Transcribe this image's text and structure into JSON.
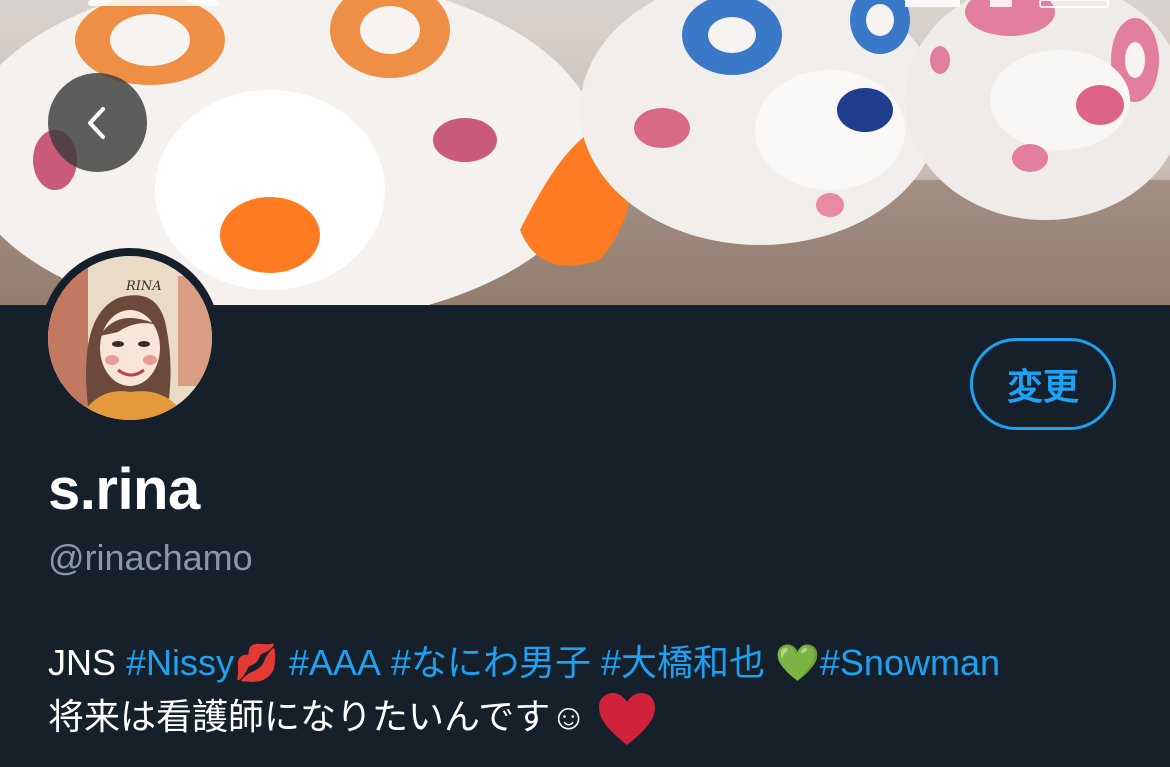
{
  "profile": {
    "display_name": "s.rina",
    "handle": "@rinachamo",
    "edit_label": "変更",
    "avatar_signature": "RINA"
  },
  "bio": {
    "line1": {
      "prefix": "JNS ",
      "tags": [
        "#Nissy",
        "#AAA",
        "#なにわ男子",
        "#大橋和也",
        "#Snowman"
      ],
      "kiss_emoji": "💋",
      "green_heart_emoji": "💚"
    },
    "line2": {
      "text": "将来は看護師になりたいんです☺︎"
    }
  },
  "icons": {
    "back": "chevron-left-icon",
    "heart": "red-heart-icon"
  },
  "colors": {
    "background": "#15202b",
    "accent": "#1da1f2",
    "handle": "#8899a6"
  }
}
